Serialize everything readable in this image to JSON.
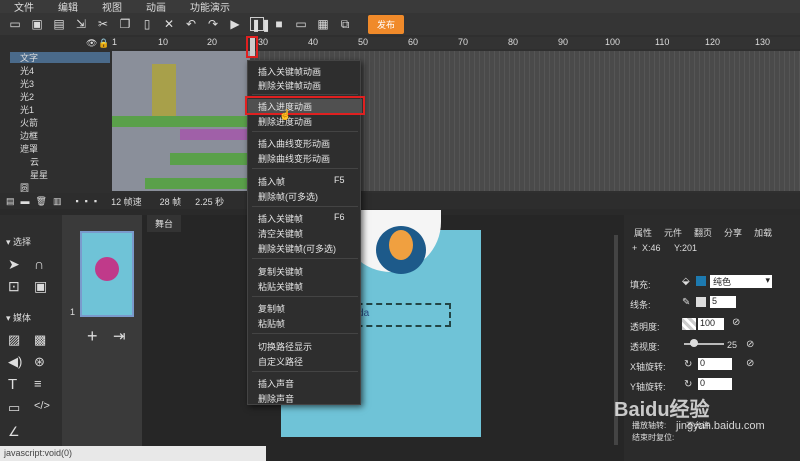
{
  "menubar": {
    "items": [
      "文件",
      "编辑",
      "视图",
      "动画",
      "功能演示"
    ]
  },
  "toolbar": {
    "publish_label": "发布"
  },
  "timeline": {
    "ruler_ticks": [
      "1",
      "10",
      "20",
      "30",
      "40",
      "50",
      "60",
      "70",
      "80",
      "90",
      "100",
      "110",
      "120",
      "130"
    ],
    "layers": [
      "文字",
      "光4",
      "光3",
      "光2",
      "光1",
      "火箭",
      "边框",
      "遮罩",
      "云",
      "星星",
      "圆"
    ],
    "status": {
      "fps": "12 帧速",
      "frames": "28 帧",
      "time": "2.25 秒"
    }
  },
  "tools": {
    "select_label": "选择",
    "media_label": "媒体"
  },
  "thumbs": {
    "page_number": "1"
  },
  "stage": {
    "tab_label": "舞台",
    "text": "mugeda"
  },
  "props": {
    "tabs": [
      "属性",
      "元件",
      "翻页",
      "分享",
      "加载"
    ],
    "x": "X:46",
    "y": "Y:201",
    "fill_label": "填充:",
    "fill_value": "纯色",
    "stroke_label": "线条:",
    "stroke_width": "5",
    "transparency_label": "透明度:",
    "transparency_value": "100",
    "rotation_label": "透视度:",
    "rotation_value": "25",
    "xrot_label": "X轴旋转:",
    "xrot_value": "0",
    "yrot_label": "Y轴旋转:",
    "yrot_value": "0",
    "extra1": "播放轴转:",
    "extra1_value": "不允许",
    "extra2": "结束时复位:"
  },
  "context_menu": {
    "items": [
      "插入关键帧动画",
      "删除关键帧动画",
      "插入进度动画",
      "删除进度动画",
      "插入曲线变形动画",
      "删除曲线变形动画",
      "插入帧",
      "删除帧(可多选)",
      "插入关键帧",
      "清空关键帧",
      "删除关键帧(可多选)",
      "复制关键帧",
      "粘贴关键帧",
      "复制帧",
      "粘贴帧",
      "切换路径显示",
      "自定义路径",
      "插入声音",
      "删除声音"
    ],
    "shortcut_insert_frame": "F5",
    "shortcut_insert_keyframe": "F6"
  },
  "footer": {
    "status": "javascript:void(0)"
  },
  "watermark": {
    "brand": "Baidu经验",
    "url": "jingyan.baidu.com"
  }
}
